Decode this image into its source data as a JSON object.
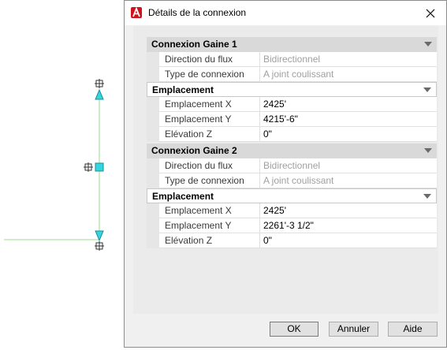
{
  "dialog": {
    "title": "Détails de la connexion",
    "close_glyph": "✕",
    "sections": [
      {
        "label": "Connexion Gaine 1",
        "rows": [
          {
            "name": "Direction du flux",
            "value": "Bidirectionnel"
          },
          {
            "name": "Type de connexion",
            "value": "A joint coulissant"
          }
        ],
        "sub_label": "Emplacement",
        "sub_rows": [
          {
            "name": "Emplacement X",
            "value": "2425'"
          },
          {
            "name": "Emplacement Y",
            "value": "4215'-6\""
          },
          {
            "name": "Elévation Z",
            "value": "0\""
          }
        ]
      },
      {
        "label": "Connexion Gaine 2",
        "rows": [
          {
            "name": "Direction du flux",
            "value": "Bidirectionnel"
          },
          {
            "name": "Type de connexion",
            "value": "A joint coulissant"
          }
        ],
        "sub_label": "Emplacement",
        "sub_rows": [
          {
            "name": "Emplacement X",
            "value": "2425'"
          },
          {
            "name": "Emplacement Y",
            "value": "2261'-3 1/2\""
          },
          {
            "name": "Elévation Z",
            "value": "0\""
          }
        ]
      }
    ],
    "buttons": {
      "ok": "OK",
      "cancel": "Annuler",
      "help": "Aide"
    }
  },
  "colors": {
    "accent_red": "#d0121b",
    "grip_cyan": "#33d6e0",
    "duct_green": "#9fd98a"
  }
}
